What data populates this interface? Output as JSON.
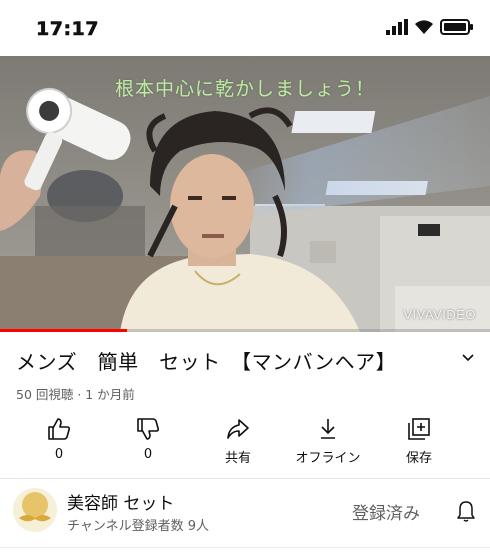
{
  "status": {
    "time": "17:17"
  },
  "video": {
    "caption": "根本中心に乾かしましょう！",
    "watermark": "VIVAVIDEO",
    "progress": 0.26
  },
  "details": {
    "title": "メンズ　簡単　セット　【マンバンヘア】",
    "meta": "50 回視聴 · 1 か月前"
  },
  "actions": [
    {
      "icon": "thumbs-up-icon",
      "label": "0"
    },
    {
      "icon": "thumbs-down-icon",
      "label": "0"
    },
    {
      "icon": "share-icon",
      "label": "共有"
    },
    {
      "icon": "download-icon",
      "label": "オフライン"
    },
    {
      "icon": "save-playlist-icon",
      "label": "保存"
    }
  ],
  "channel": {
    "name": "美容師 セット",
    "subscribers": "チャンネル登録者数 9人",
    "subscribe_state": "登録済み"
  },
  "colors": {
    "accent": "#ff0000",
    "caption": "#bfe9a6",
    "secondary_text": "#606060"
  }
}
